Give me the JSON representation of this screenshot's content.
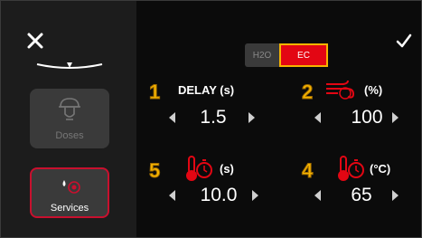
{
  "sidebar": {
    "doses_label": "Doses",
    "services_label": "Services"
  },
  "mode_toggle": {
    "h2o_label": "H2O",
    "ec_label": "EC",
    "selected": "EC"
  },
  "params": {
    "p1": {
      "number": "1",
      "label": "DELAY (s)",
      "value": "1.5"
    },
    "p2": {
      "number": "2",
      "icon": "fan-icon",
      "unit": "(%)",
      "value": "100"
    },
    "p5": {
      "number": "5",
      "icon": "thermometer-timer-icon",
      "unit": "(s)",
      "value": "10.0"
    },
    "p4": {
      "number": "4",
      "icon": "thermometer-timer-icon",
      "unit": "(°C)",
      "value": "65"
    }
  },
  "colors": {
    "accent_red": "#e30613",
    "accent_yellow": "#f6b400",
    "sidebar_bg": "#1c1c1c",
    "button_bg": "#3a3a3a"
  }
}
